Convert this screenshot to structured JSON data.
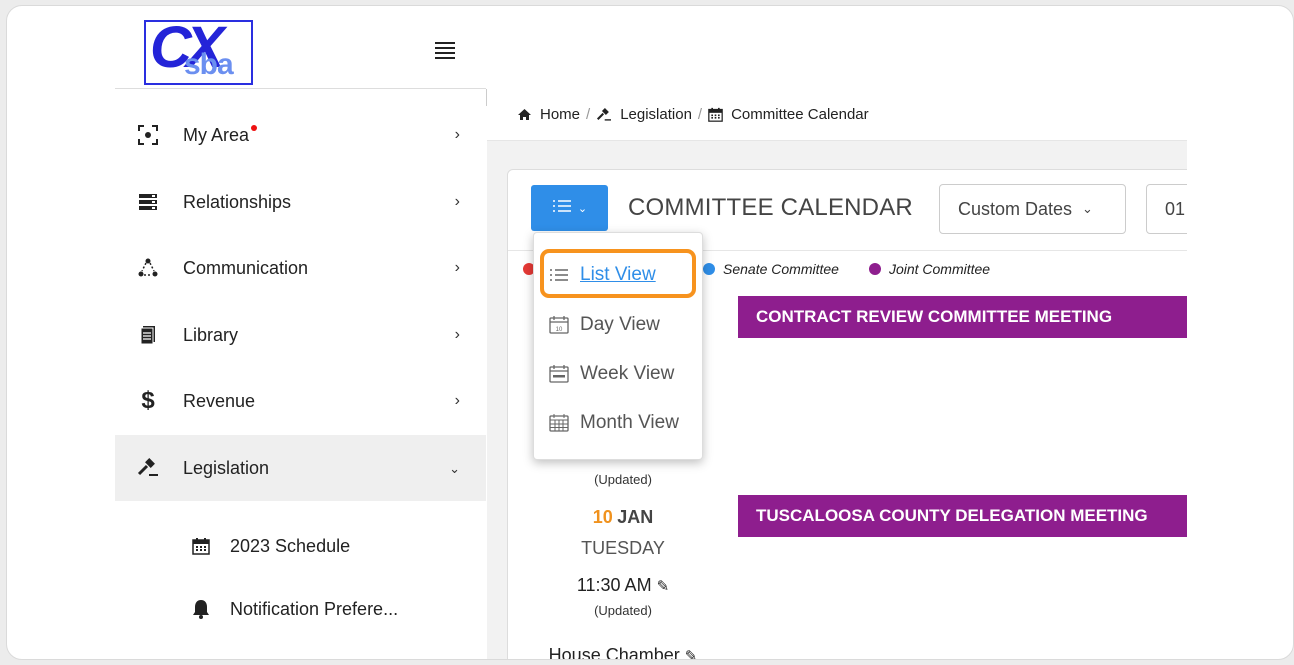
{
  "logo": {
    "letters_main": "CX",
    "letters_sub": "sba"
  },
  "sidebar": {
    "items": [
      {
        "label": "My Area",
        "icon": "focus-icon",
        "has_badge": true
      },
      {
        "label": "Relationships",
        "icon": "server-icon"
      },
      {
        "label": "Communication",
        "icon": "network-icon"
      },
      {
        "label": "Library",
        "icon": "documents-icon"
      },
      {
        "label": "Revenue",
        "icon": "dollar-icon"
      },
      {
        "label": "Legislation",
        "icon": "gavel-icon",
        "active": true
      }
    ],
    "sub_items": [
      {
        "label": "2023 Schedule",
        "icon": "calendar-icon"
      },
      {
        "label": "Notification Prefere...",
        "icon": "bell-icon"
      }
    ]
  },
  "breadcrumb": {
    "home": "Home",
    "legislation": "Legislation",
    "current": "Committee Calendar",
    "separator": "/"
  },
  "calendar": {
    "title": "COMMITTEE CALENDAR",
    "date_range_select": "Custom Dates",
    "date_input": "01",
    "legend": [
      {
        "label": "Senate Committee",
        "color": "#2f8ee8"
      },
      {
        "label": "Joint Committee",
        "color": "#8e1e8e"
      }
    ],
    "events": [
      {
        "title": "CONTRACT REVIEW COMMITTEE MEETING"
      },
      {
        "title": "TUSCALOOSA COUNTY DELEGATION MEETING",
        "updated_note": "(Updated)",
        "day": "10",
        "month": "JAN",
        "weekday": "TUESDAY",
        "time": "11:30 AM",
        "time_note": "(Updated)",
        "location": "House Chamber"
      }
    ]
  },
  "view_menu": {
    "items": [
      {
        "label": "List View",
        "icon": "list-icon",
        "selected": true
      },
      {
        "label": "Day View",
        "icon": "calendar-day-icon"
      },
      {
        "label": "Week View",
        "icon": "calendar-week-icon"
      },
      {
        "label": "Month View",
        "icon": "calendar-month-icon"
      }
    ]
  },
  "colors": {
    "accent": "#2f8ee8",
    "event": "#8e1e8e",
    "highlight": "#f7931e",
    "date": "#f0921e"
  }
}
